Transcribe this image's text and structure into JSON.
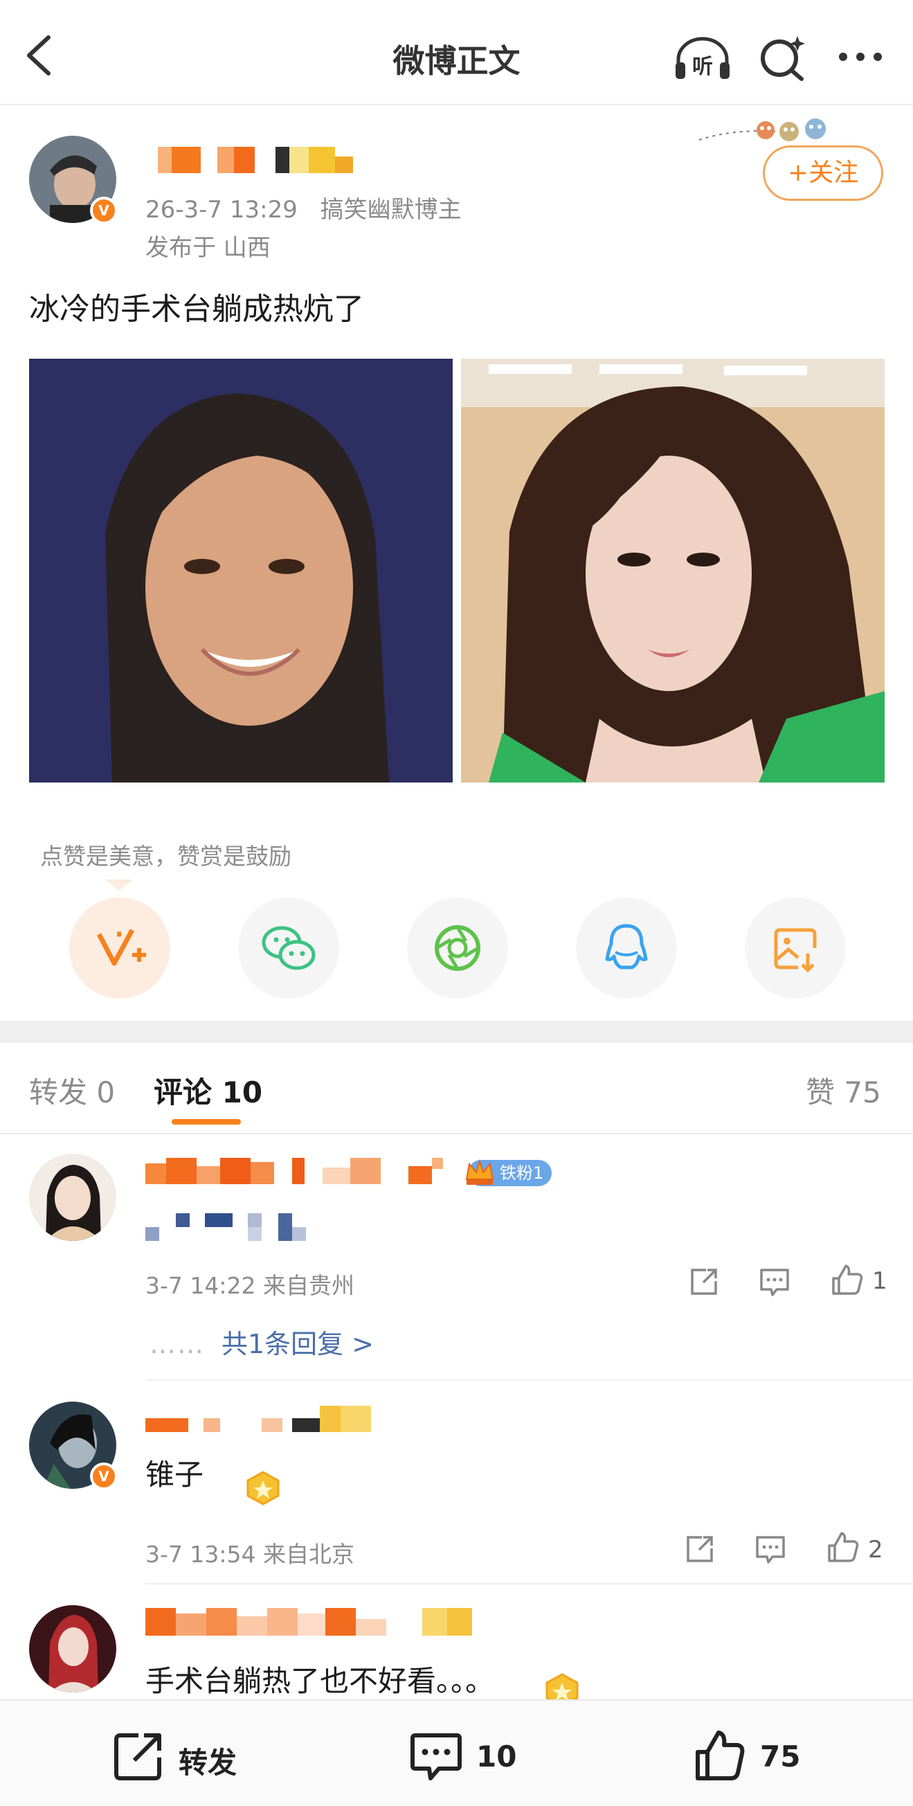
{
  "nav": {
    "title": "微博正文",
    "listen_label": "听"
  },
  "post": {
    "timestamp": "26-3-7 13:29",
    "author_tag": "搞笑幽默博主",
    "location": "发布于 山西",
    "follow_label": "+关注",
    "text": "冰冷的手术台躺成热炕了",
    "verified_mark": "V"
  },
  "reward": {
    "hint": "点赞是美意，赞赏是鼓励"
  },
  "share_icons": [
    "weibo-reward-icon",
    "wechat-icon",
    "moments-icon",
    "qq-icon",
    "save-image-icon"
  ],
  "tabs": {
    "repost": "转发 0",
    "comment": "评论 10",
    "like": "赞 75"
  },
  "comments": [
    {
      "badge": "铁粉1",
      "meta": "3-7 14:22  来自贵州",
      "likes": "1",
      "replies_label": "共1条回复 >"
    },
    {
      "text": "锥子",
      "meta": "3-7 13:54  来自北京",
      "likes": "2"
    },
    {
      "text": "手术台躺热了也不好看。。。"
    }
  ],
  "bottom_bar": {
    "repost": "转发",
    "comment_count": "10",
    "like_count": "75"
  },
  "colors": {
    "accent": "#f7811d",
    "link": "#4a6ea8"
  }
}
